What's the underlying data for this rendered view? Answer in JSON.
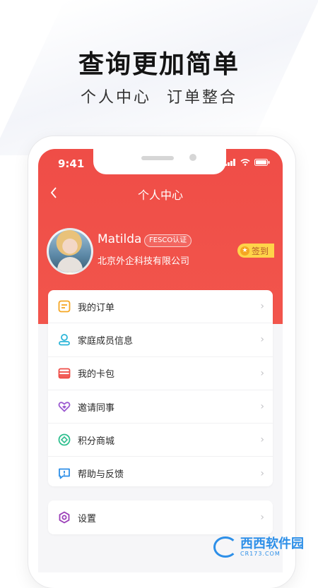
{
  "promo": {
    "headline": "查询更加简单",
    "subline_left": "个人中心",
    "subline_right": "订单整合"
  },
  "status_bar": {
    "time": "9:41"
  },
  "nav": {
    "title": "个人中心",
    "back_icon": "chevron-left-icon"
  },
  "profile": {
    "name": "Matilda",
    "badge": "FESCO认证",
    "company": "北京外企科技有限公司",
    "signin_label": "签到"
  },
  "menu": {
    "items": [
      {
        "label": "我的订单",
        "icon": "order-icon",
        "color": "#f5a623"
      },
      {
        "label": "家庭成员信息",
        "icon": "family-member-icon",
        "color": "#2bb5d8"
      },
      {
        "label": "我的卡包",
        "icon": "wallet-icon",
        "color": "#ef4d47"
      },
      {
        "label": "邀请同事",
        "icon": "heart-icon",
        "color": "#9b59d0"
      },
      {
        "label": "积分商城",
        "icon": "points-mall-icon",
        "color": "#2fbf8f"
      },
      {
        "label": "帮助与反馈",
        "icon": "help-feedback-icon",
        "color": "#2d8fe8"
      }
    ]
  },
  "settings": {
    "label": "设置",
    "icon": "settings-icon",
    "color": "#9b3fb8"
  },
  "colors": {
    "brand_red": "#ef4d47",
    "signin_yellow": "#ffd449"
  },
  "watermark": {
    "text": "西西软件园",
    "sub": "CR173.COM"
  }
}
